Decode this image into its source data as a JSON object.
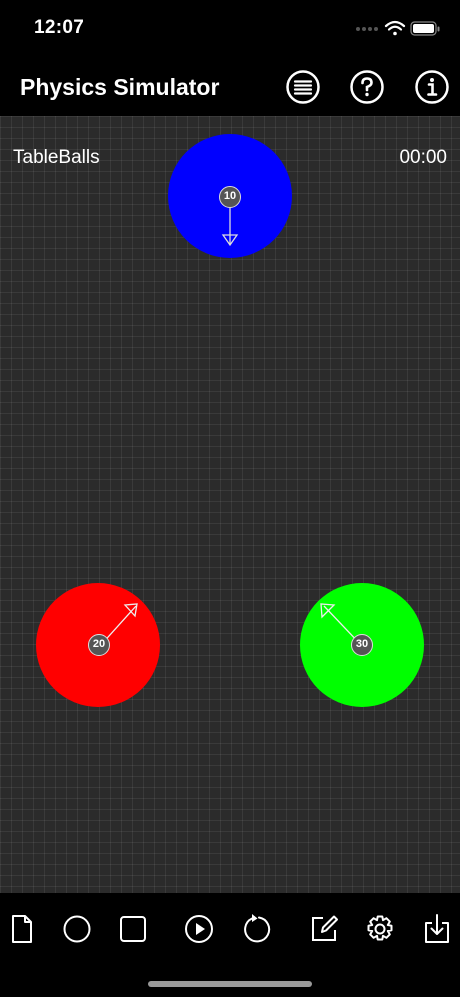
{
  "status": {
    "time": "12:07"
  },
  "header": {
    "title": "Physics Simulator"
  },
  "simulation": {
    "name": "TableBalls",
    "elapsed": "00:00"
  },
  "balls": [
    {
      "label": "10",
      "color": "#0000ff",
      "direction": "down"
    },
    {
      "label": "20",
      "color": "#ff0000",
      "direction": "up-right"
    },
    {
      "label": "30",
      "color": "#00ff00",
      "direction": "up-left"
    }
  ],
  "toolbar": {
    "icons": [
      "document-icon",
      "circle-icon",
      "square-icon",
      "play-icon",
      "reset-icon",
      "edit-icon",
      "settings-icon",
      "download-icon"
    ]
  }
}
